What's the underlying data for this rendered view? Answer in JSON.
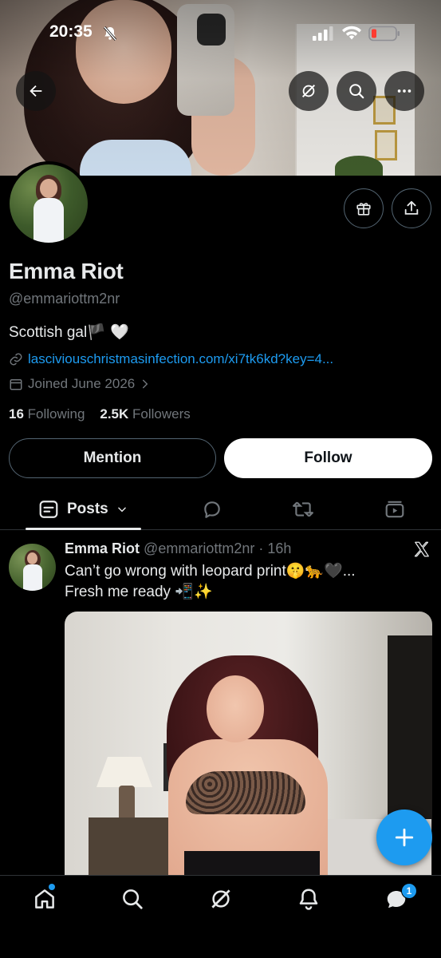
{
  "status_bar": {
    "time": "20:35"
  },
  "profile": {
    "name": "Emma Riot",
    "handle": "@emmariottm2nr",
    "bio": "Scottish gal🏴 🤍",
    "link": "lasciviouschristmasinfection.com/xi7tk6kd?key=4...",
    "joined": "Joined June 2026",
    "following_count": "16",
    "following_label": "Following",
    "followers_count": "2.5K",
    "followers_label": "Followers"
  },
  "actions": {
    "mention_label": "Mention",
    "follow_label": "Follow"
  },
  "tabs": {
    "posts_label": "Posts"
  },
  "post": {
    "author_name": "Emma Riot",
    "author_handle": "@emmariottm2nr",
    "separator": "·",
    "time": "16h",
    "text_line1": "Can’t go wrong with leopard print🤫🐆🖤...",
    "text_line2": "Fresh me ready 📲✨"
  },
  "bottom_nav": {
    "messages_badge": "1"
  },
  "colors": {
    "accent": "#1d9bf0",
    "background": "#000000",
    "text": "#e7e9ea",
    "muted": "#71767b",
    "border": "#2f3336"
  },
  "icons": [
    "back-arrow-icon",
    "grok-icon",
    "search-icon",
    "more-icon",
    "gift-icon",
    "share-icon",
    "link-icon",
    "calendar-icon",
    "chevron-right-icon",
    "posts-icon",
    "chevron-down-icon",
    "reply-icon",
    "repost-icon",
    "video-icon",
    "x-logo-icon",
    "plus-icon",
    "home-icon",
    "bell-icon",
    "messages-icon"
  ]
}
